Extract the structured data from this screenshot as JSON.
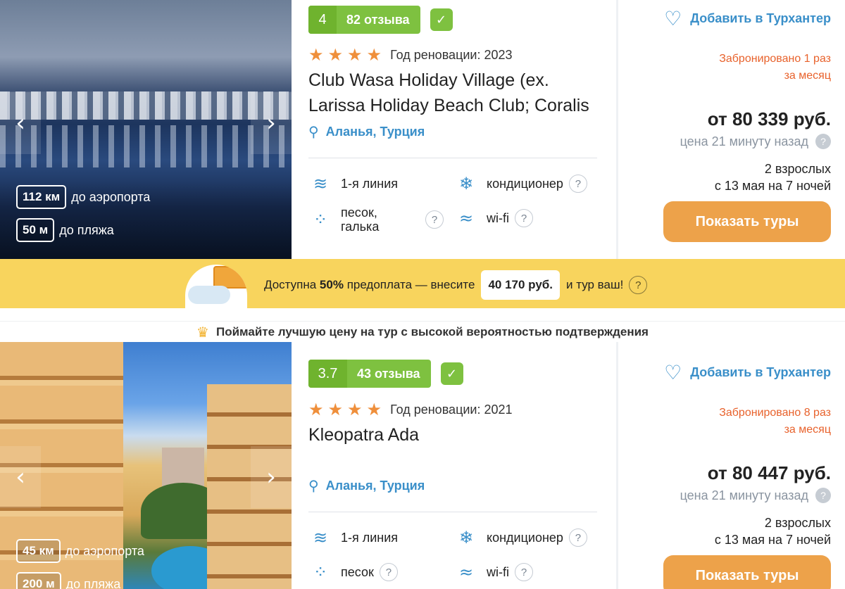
{
  "banner": {
    "prefix": "Доступна",
    "percent": "50%",
    "middle": "предоплата — внесите",
    "amount": "40 170 руб.",
    "suffix": "и тур ваш!"
  },
  "promo": {
    "text": "Поймайте лучшую цену на тур с высокой вероятностью подтверждения",
    "icon": "crown-icon"
  },
  "hotels": [
    {
      "rating": "4",
      "reviews": "82 отзыва",
      "stars": 4,
      "renovation": "Год реновации: 2023",
      "name": "Club Wasa Holiday Village (ex. Larissa Holiday Beach Club; Coralis",
      "location": "Аланья, Турция",
      "airport_distance": "112 км",
      "airport_label": "до аэропорта",
      "beach_distance": "50 м",
      "beach_label": "до пляжа",
      "features": {
        "line": "1-я линия",
        "beach_type": "песок, галька",
        "ac": "кондиционер",
        "wifi": "wi-fi"
      },
      "favorite": "Добавить в Турхантер",
      "booked_line1": "Забронировано 1 раз",
      "booked_line2": "за месяц",
      "price": "от 80 339 руб.",
      "price_age": "цена 21 минуту назад",
      "pax": "2 взрослых",
      "dates": "с 13 мая на 7 ночей",
      "button": "Показать туры"
    },
    {
      "rating": "3.7",
      "reviews": "43 отзыва",
      "stars": 4,
      "renovation": "Год реновации: 2021",
      "name": "Kleopatra Ada",
      "location": "Аланья, Турция",
      "airport_distance": "45 км",
      "airport_label": "до аэропорта",
      "beach_distance": "200 м",
      "beach_label": "до пляжа",
      "features": {
        "line": "1-я линия",
        "beach_type": "песок",
        "ac": "кондиционер",
        "wifi": "wi-fi"
      },
      "favorite": "Добавить в Турхантер",
      "booked_line1": "Забронировано 8 раз",
      "booked_line2": "за месяц",
      "price": "от 80 447 руб.",
      "price_age": "цена 21 минуту назад",
      "pax": "2 взрослых",
      "dates": "с 13 мая на 7 ночей",
      "button": "Показать туры"
    }
  ],
  "colors": {
    "accent_blue": "#3a8fc9",
    "rating_green": "#7ec140",
    "star_orange": "#ef8f3b",
    "booked_red": "#e8622c",
    "button_orange": "#eda24a",
    "banner_yellow": "#f8d45d"
  }
}
